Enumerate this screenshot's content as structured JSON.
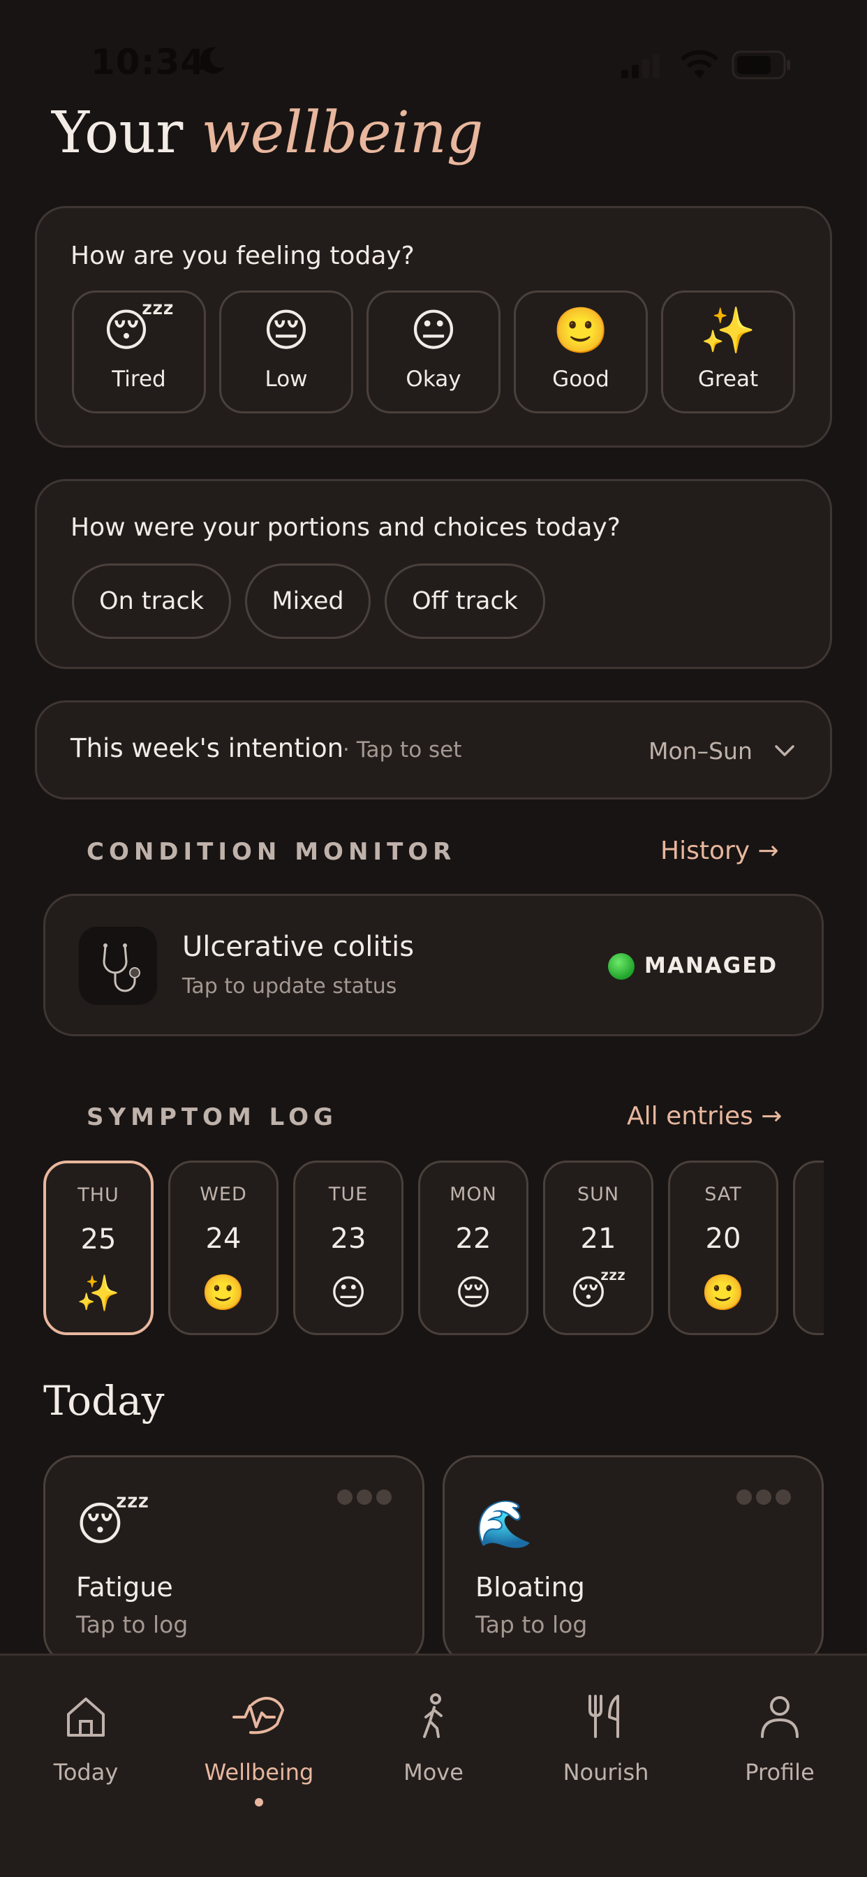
{
  "status_bar": {
    "time": "10:34"
  },
  "page": {
    "title_plain": "Your",
    "title_accent": "wellbeing"
  },
  "feeling": {
    "question": "How are you feeling today?",
    "options": [
      {
        "label": "Tired",
        "emoji": "😴"
      },
      {
        "label": "Low",
        "emoji": "😔"
      },
      {
        "label": "Okay",
        "emoji": "😐"
      },
      {
        "label": "Good",
        "emoji": "🙂"
      },
      {
        "label": "Great",
        "emoji": "✨"
      }
    ]
  },
  "portions": {
    "question": "How were your portions and choices today?",
    "options": [
      "On track",
      "Mixed",
      "Off track"
    ]
  },
  "intention": {
    "title": "This week's intention",
    "tap": "· Tap to set",
    "range": "Mon–Sun"
  },
  "condition_monitor": {
    "label": "CONDITION MONITOR",
    "link": "History →",
    "name": "Ulcerative colitis",
    "sub": "Tap to update status",
    "status": "MANAGED",
    "status_color": "#22a52c"
  },
  "symptom_log": {
    "label": "SYMPTOM LOG",
    "link": "All entries →",
    "days": [
      {
        "dow": "THU",
        "num": "25",
        "emoji": "✨",
        "active": true
      },
      {
        "dow": "WED",
        "num": "24",
        "emoji": "🙂"
      },
      {
        "dow": "TUE",
        "num": "23",
        "emoji": "😐"
      },
      {
        "dow": "MON",
        "num": "22",
        "emoji": "😔"
      },
      {
        "dow": "SUN",
        "num": "21",
        "emoji": "😴"
      },
      {
        "dow": "SAT",
        "num": "20",
        "emoji": "🙂"
      }
    ]
  },
  "today": {
    "title": "Today",
    "cards": [
      {
        "emoji": "😴",
        "name": "Fatigue",
        "sub": "Tap to log"
      },
      {
        "emoji": "🌊",
        "name": "Bloating",
        "sub": "Tap to log"
      }
    ]
  },
  "tabbar": {
    "items": [
      {
        "label": "Today",
        "icon": "home-icon"
      },
      {
        "label": "Wellbeing",
        "icon": "heartbeat-hands-icon",
        "active": true
      },
      {
        "label": "Move",
        "icon": "walking-icon"
      },
      {
        "label": "Nourish",
        "icon": "fork-knife-icon"
      },
      {
        "label": "Profile",
        "icon": "person-icon"
      }
    ]
  },
  "colors": {
    "accent": "#e8b79e",
    "background": "#181413",
    "card": "#221d1b"
  }
}
